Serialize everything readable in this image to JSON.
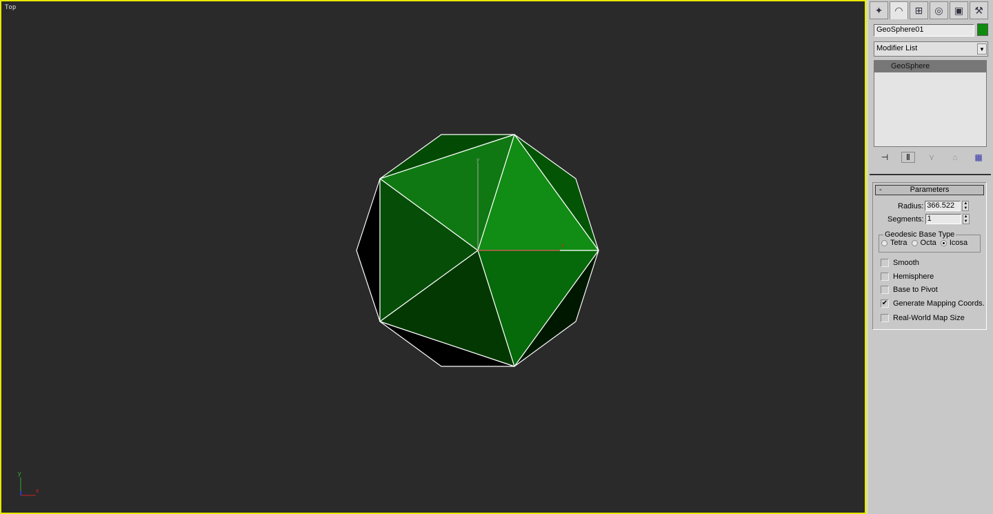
{
  "viewport": {
    "label": "Top",
    "border_color": "#e8e800",
    "axis_labels": {
      "x": "x",
      "y": "y"
    }
  },
  "object": {
    "name": "GeoSphere01",
    "color": "#0e8c0e"
  },
  "tabs": [
    {
      "icon": "create-icon"
    },
    {
      "icon": "modify-icon"
    },
    {
      "icon": "hierarchy-icon"
    },
    {
      "icon": "motion-icon"
    },
    {
      "icon": "display-icon"
    },
    {
      "icon": "utilities-icon"
    }
  ],
  "modifier_list": {
    "label": "Modifier List"
  },
  "stack": {
    "items": [
      "GeoSphere"
    ]
  },
  "parameters": {
    "title": "Parameters",
    "collapse": "-",
    "radius_label": "Radius:",
    "radius": "366.522",
    "segments_label": "Segments:",
    "segments": "1",
    "base_type": {
      "label": "Geodesic Base Type",
      "options": [
        "Tetra",
        "Octa",
        "Icosa"
      ],
      "selected": "Icosa"
    },
    "checkboxes": [
      {
        "label": "Smooth",
        "checked": false
      },
      {
        "label": "Hemisphere",
        "checked": false
      },
      {
        "label": "Base to Pivot",
        "checked": false
      },
      {
        "label": "Generate Mapping Coords.",
        "checked": true
      },
      {
        "label": "Real-World Map Size",
        "checked": false
      }
    ]
  }
}
